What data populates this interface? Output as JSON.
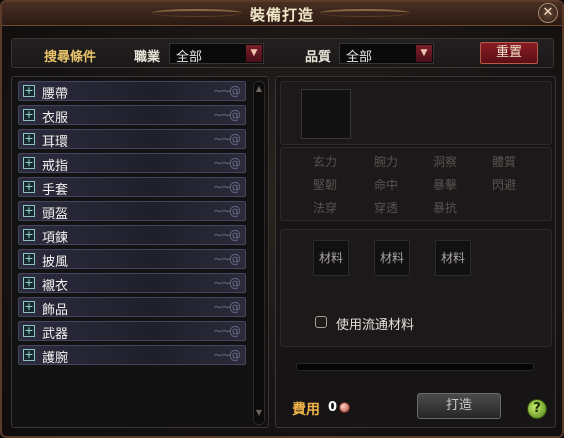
{
  "window": {
    "title": "裝備打造",
    "close_glyph": "✕"
  },
  "filter": {
    "title": "搜尋條件",
    "job_label": "職業",
    "job_value": "全部",
    "quality_label": "品質",
    "quality_value": "全部",
    "reset_label": "重置"
  },
  "categories": [
    {
      "label": "腰帶"
    },
    {
      "label": "衣服"
    },
    {
      "label": "耳環"
    },
    {
      "label": "戒指"
    },
    {
      "label": "手套"
    },
    {
      "label": "頭盔"
    },
    {
      "label": "項鍊"
    },
    {
      "label": "披風"
    },
    {
      "label": "襯衣"
    },
    {
      "label": "飾品"
    },
    {
      "label": "武器"
    },
    {
      "label": "護腕"
    }
  ],
  "stats": [
    "玄力",
    "腕力",
    "洞察",
    "體質",
    "堅韌",
    "命中",
    "暴擊",
    "閃避",
    "法穿",
    "穿透",
    "暴抗"
  ],
  "materials": [
    "材料",
    "材料",
    "材料"
  ],
  "use_circulating_materials_label": "使用流通材料",
  "cost": {
    "label": "費用",
    "value": "0"
  },
  "forge_label": "打造",
  "help_glyph": "?",
  "colors": {
    "accent_gold": "#e9c46a",
    "reset_red": "#8a1d24",
    "cost_orange": "#efb34a"
  }
}
